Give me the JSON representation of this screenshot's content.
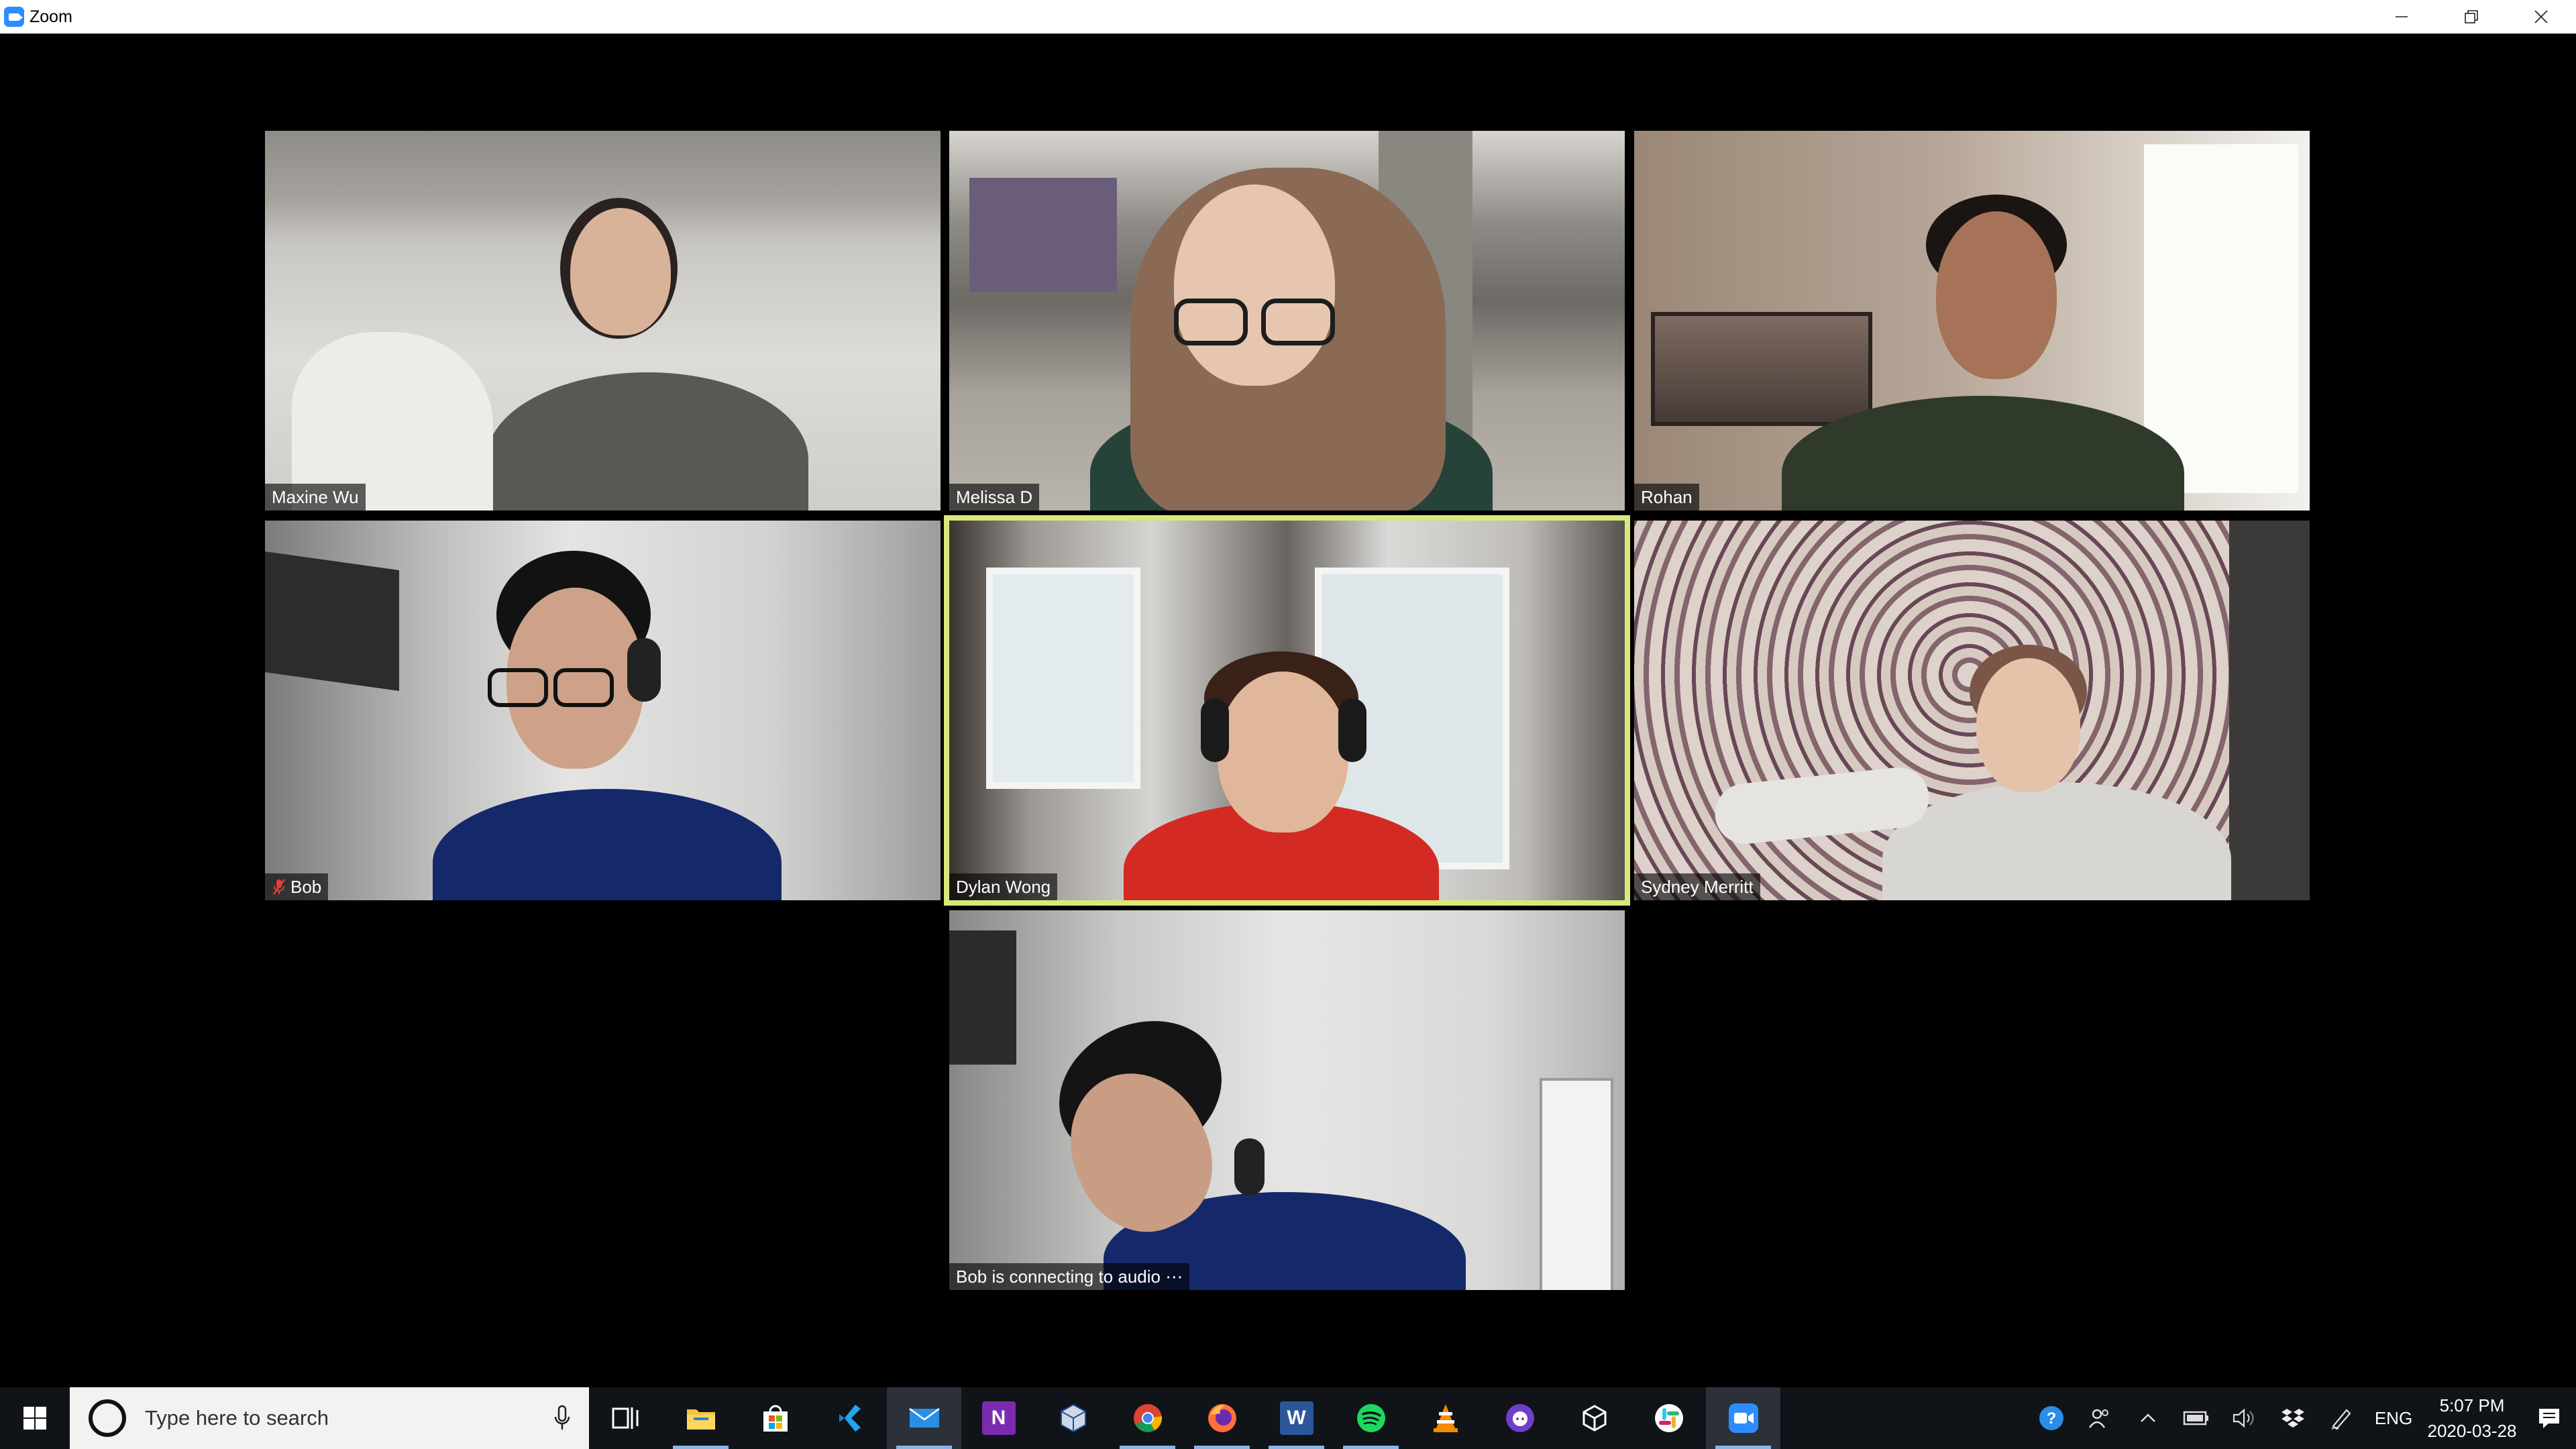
{
  "window": {
    "title": "Zoom"
  },
  "participants": [
    {
      "name": "Maxine Wu"
    },
    {
      "name": "Melissa D"
    },
    {
      "name": "Rohan"
    },
    {
      "name": "Bob",
      "muted": true
    },
    {
      "name": "Dylan Wong",
      "active_speaker": true
    },
    {
      "name": "Sydney Merritt"
    },
    {
      "name": "Bob is connecting to audio ⋯"
    }
  ],
  "taskbar": {
    "search_placeholder": "Type here to search",
    "apps": [
      "task-view",
      "file-explorer",
      "microsoft-store",
      "visual-studio-code",
      "mail",
      "onenote",
      "virtualbox",
      "chrome",
      "firefox",
      "word",
      "spotify",
      "vlc",
      "github-desktop",
      "unity",
      "slack",
      "zoom"
    ],
    "language": "ENG",
    "time": "5:07 PM",
    "date": "2020-03-28"
  },
  "colors": {
    "active_speaker_border": "#d9e87a",
    "zoom_blue": "#2d8cff",
    "mute_red": "#e0403a"
  }
}
